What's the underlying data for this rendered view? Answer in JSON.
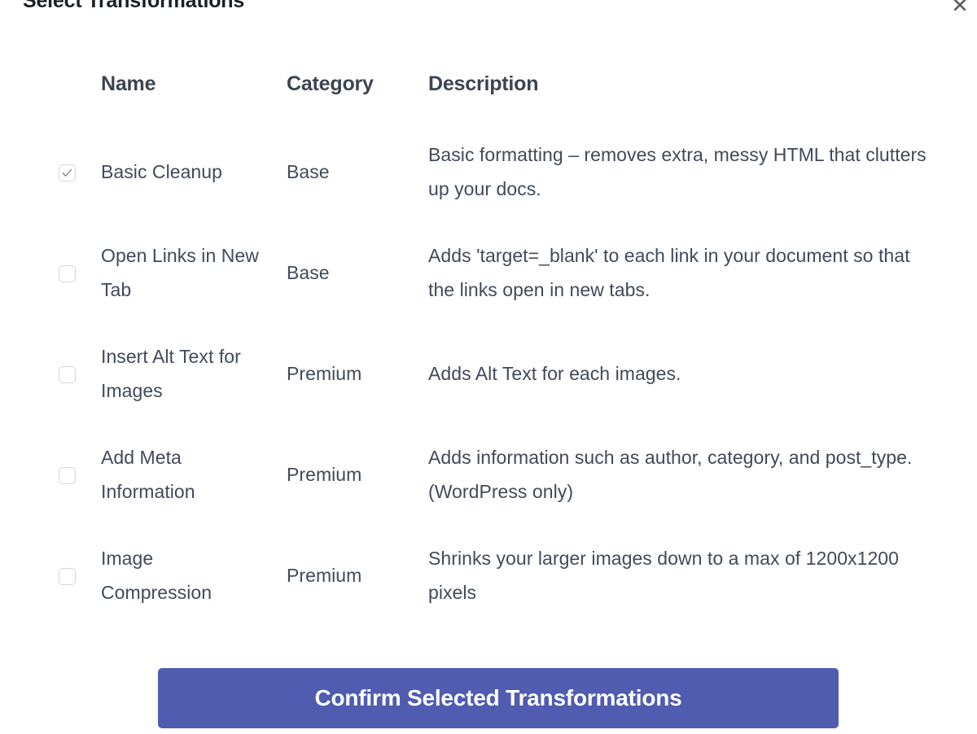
{
  "modal": {
    "title": "Select Transformations",
    "close_icon": "close-icon"
  },
  "table": {
    "headers": {
      "name": "Name",
      "category": "Category",
      "description": "Description"
    },
    "rows": [
      {
        "checked": true,
        "name": "Basic Cleanup",
        "category": "Base",
        "description": "Basic formatting – removes extra, messy HTML that clutters up your docs."
      },
      {
        "checked": false,
        "name": "Open Links in New Tab",
        "category": "Base",
        "description": "Adds 'target=_blank' to each link in your document so that the links open in new tabs."
      },
      {
        "checked": false,
        "name": "Insert Alt Text for Images",
        "category": "Premium",
        "description": "Adds Alt Text for each images."
      },
      {
        "checked": false,
        "name": "Add Meta Information",
        "category": "Premium",
        "description": "Adds information such as author, category, and post_type. (WordPress only)"
      },
      {
        "checked": false,
        "name": "Image Compression",
        "category": "Premium",
        "description": "Shrinks your larger images down to a max of 1200x1200 pixels"
      }
    ]
  },
  "footer": {
    "confirm_label": "Confirm Selected Transformations",
    "confirm_color": "#4f5cb0"
  }
}
